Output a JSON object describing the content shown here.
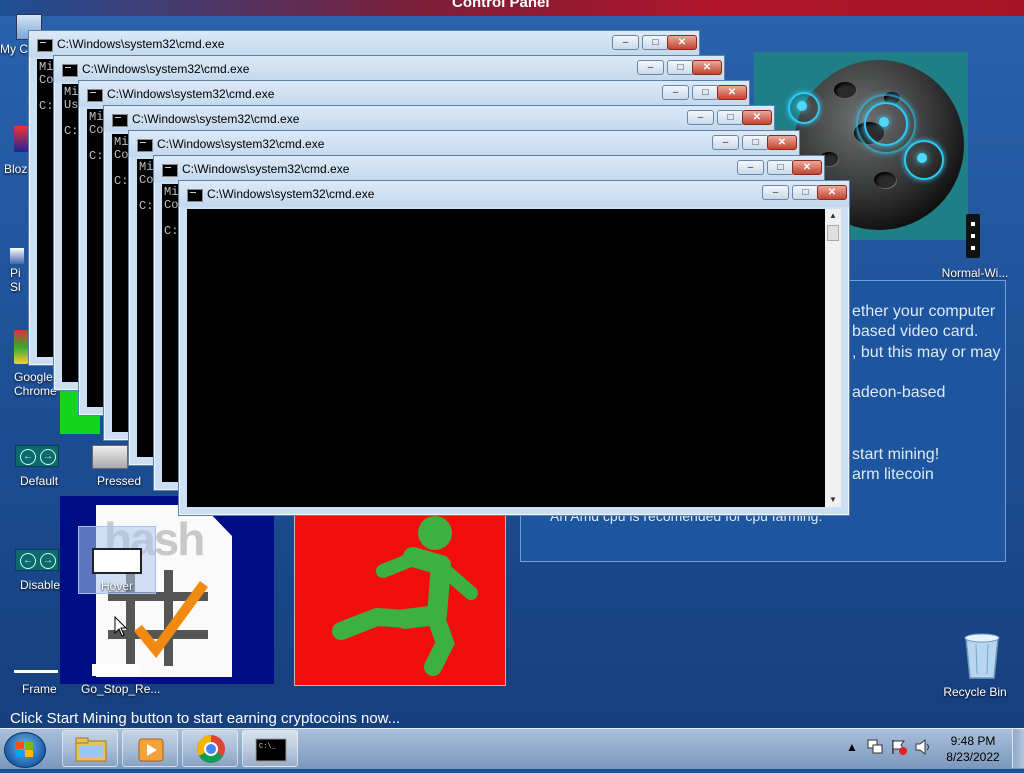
{
  "top_bar": {
    "title": "Control Panel"
  },
  "miner_panel": {
    "lines": [
      "ether your computer",
      "based video card.",
      ", but this may or may",
      "adeon-based",
      "start mining!",
      "arm litecoin",
      "An Amd cpu is recomended for cpu farming."
    ]
  },
  "desktop_icons": {
    "my_computer": "My C",
    "bloz": "Bloz",
    "pi": "Pi",
    "sl": "Sl",
    "chrome": "Google Chrome",
    "default": "Default",
    "pressed": "Pressed",
    "disable": "Disable",
    "hover": "Hover",
    "frame": "Frame",
    "go_stop": "Go_Stop_Re...",
    "normal_wi": "Normal-Wi...",
    "recycle_bin": "Recycle Bin"
  },
  "status_message": "Click Start Mining button to start earning cryptocoins now...",
  "cmd_windows": [
    {
      "title": "C:\\Windows\\system32\\cmd.exe",
      "console": "Mi\nCo\n\nC:"
    },
    {
      "title": "C:\\Windows\\system32\\cmd.exe",
      "console": "Mi\nUs\n\nC:"
    },
    {
      "title": "C:\\Windows\\system32\\cmd.exe",
      "console": "Mi\nCo\n\nC:"
    },
    {
      "title": "C:\\Windows\\system32\\cmd.exe",
      "console": "Mi\nCo\n\nC:"
    },
    {
      "title": "C:\\Windows\\system32\\cmd.exe",
      "console": "Mi\nCo\n\nC:"
    },
    {
      "title": "C:\\Windows\\system32\\cmd.exe",
      "console": "Mi\nCo\n\nC:"
    },
    {
      "title": "C:\\Windows\\system32\\cmd.exe",
      "console": ""
    }
  ],
  "taskbar": {
    "items": [
      "windows-explorer",
      "media-player",
      "google-chrome",
      "command-prompt"
    ]
  },
  "clock": {
    "time": "9:48 PM",
    "date": "8/23/2022"
  },
  "colors": {
    "cmd_bg": "#000000",
    "title_bar": "#cde0f3",
    "close_red": "#c5432e",
    "desktop": "#1d4f96"
  }
}
